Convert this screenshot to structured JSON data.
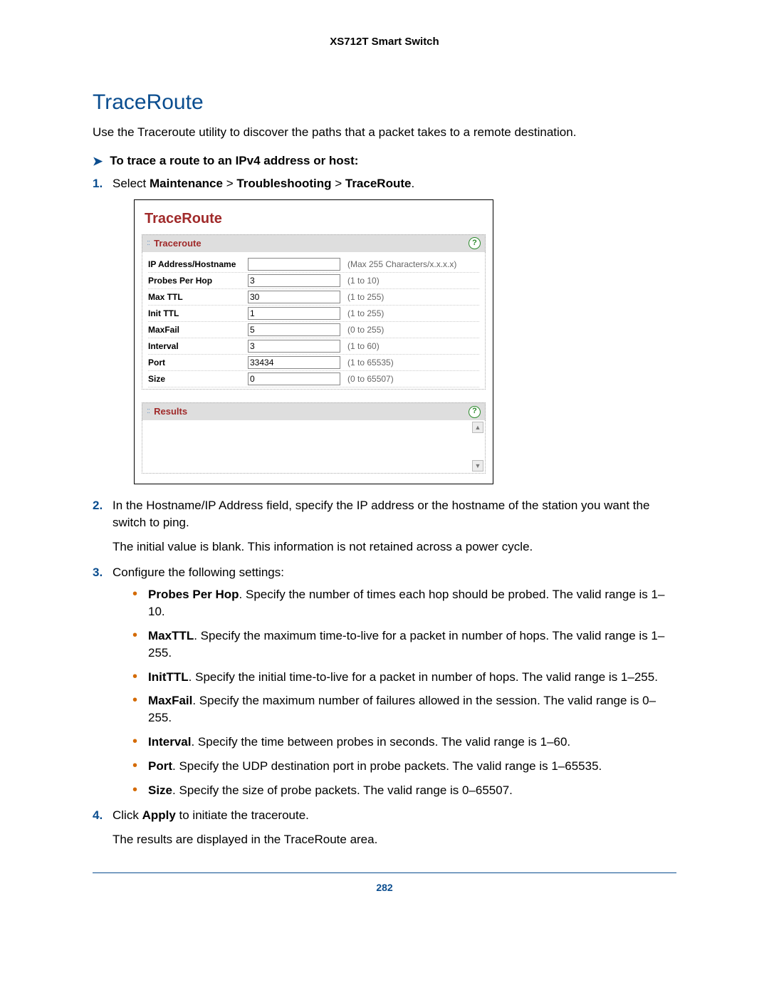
{
  "doc_header": "XS712T Smart Switch",
  "section_title": "TraceRoute",
  "intro": "Use the Traceroute utility to discover the paths that a packet takes to a remote destination.",
  "task_arrow": "➤",
  "task_title": "To trace a route to an IPv4 address or host:",
  "step1": {
    "prefix": "Select ",
    "b1": "Maintenance",
    "gt": " > ",
    "b2": "Troubleshooting",
    "b3": "TraceRoute",
    "suffix": "."
  },
  "screenshot": {
    "title": "TraceRoute",
    "panel_traceroute": "Traceroute",
    "help": "?",
    "rows": [
      {
        "label": "IP Address/Hostname",
        "value": "",
        "hint": "(Max 255 Characters/x.x.x.x)"
      },
      {
        "label": "Probes Per Hop",
        "value": "3",
        "hint": "(1 to 10)"
      },
      {
        "label": "Max TTL",
        "value": "30",
        "hint": "(1 to 255)"
      },
      {
        "label": "Init TTL",
        "value": "1",
        "hint": "(1 to 255)"
      },
      {
        "label": "MaxFail",
        "value": "5",
        "hint": "(0 to 255)"
      },
      {
        "label": "Interval",
        "value": "3",
        "hint": "(1 to 60)"
      },
      {
        "label": "Port",
        "value": "33434",
        "hint": "(1 to 65535)"
      },
      {
        "label": "Size",
        "value": "0",
        "hint": "(0 to 65507)"
      }
    ],
    "panel_results": "Results"
  },
  "step2": {
    "text": "In the Hostname/IP Address field, specify the IP address or the hostname of the station you want the switch to ping.",
    "para": "The initial value is blank. This information is not retained across a power cycle."
  },
  "step3": {
    "text": "Configure the following settings:",
    "bullets": [
      {
        "b": "Probes Per Hop",
        "t": ". Specify the number of times each hop should be probed. The valid range is 1–10."
      },
      {
        "b": "MaxTTL",
        "t": ". Specify the maximum time-to-live for a packet in number of hops. The valid range is 1–255."
      },
      {
        "b": "InitTTL",
        "t": ". Specify the initial time-to-live for a packet in number of hops. The valid range is 1–255."
      },
      {
        "b": "MaxFail",
        "t": ". Specify the maximum number of failures allowed in the session. The valid range is 0–255."
      },
      {
        "b": "Interval",
        "t": ". Specify the time between probes in seconds. The valid range is 1–60."
      },
      {
        "b": "Port",
        "t": ". Specify the UDP destination port in probe packets. The valid range is 1–65535."
      },
      {
        "b": "Size",
        "t": ". Specify the size of probe packets. The valid range is 0–65507."
      }
    ]
  },
  "step4": {
    "prefix": "Click ",
    "b": "Apply",
    "suffix": " to initiate the traceroute.",
    "para": "The results are displayed in the TraceRoute area."
  },
  "page_number": "282"
}
